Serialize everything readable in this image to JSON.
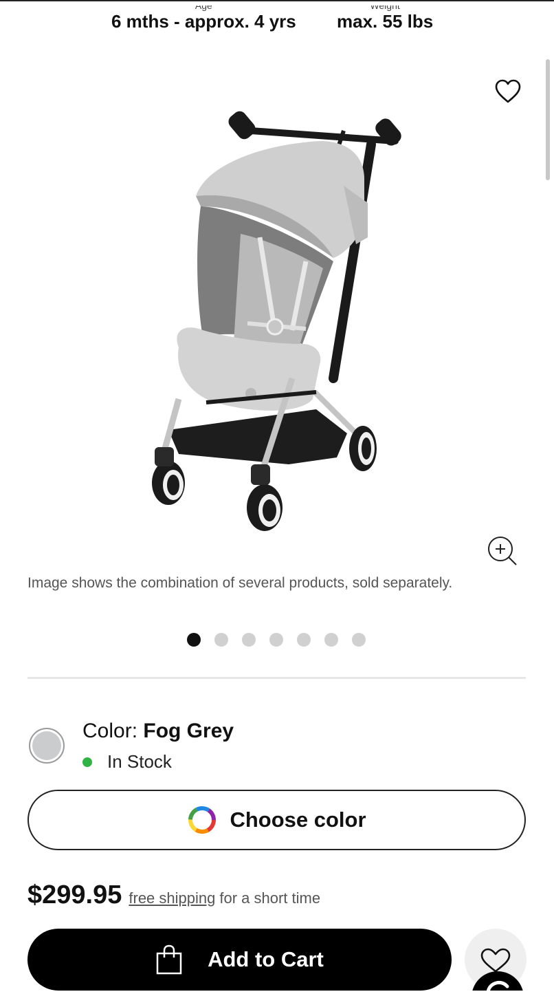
{
  "specs": {
    "age": {
      "label": "Age",
      "value": "6 mths - approx. 4 yrs"
    },
    "weight": {
      "label": "Weight",
      "value": "max. 55 lbs"
    }
  },
  "gallery": {
    "caption": "Image shows the combination of several products, sold separately.",
    "slide_count": 7,
    "active_slide": 1,
    "icons": {
      "wishlist": "heart-icon",
      "zoom": "zoom-in-icon"
    }
  },
  "color": {
    "label": "Color:",
    "value": "Fog Grey",
    "swatch": "#cbccce",
    "stock_text": "In Stock",
    "stock_color": "#2fb344",
    "choose_label": "Choose color"
  },
  "price": {
    "amount": "$299.95",
    "shipping_link": "free shipping",
    "shipping_rest": "for a short time"
  },
  "cart": {
    "label": "Add to Cart",
    "icon": "shopping-bag-icon"
  }
}
